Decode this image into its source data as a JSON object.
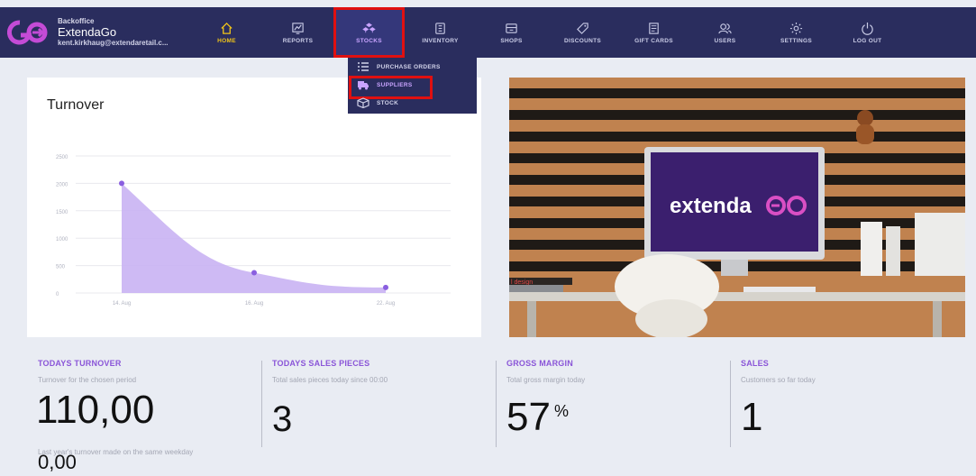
{
  "header": {
    "app_small": "Backoffice",
    "app_name": "ExtendaGo",
    "user_email": "kent.kirkhaug@extendaretail.c..."
  },
  "nav": {
    "home": "HOME",
    "reports": "REPORTS",
    "stocks": "STOCKS",
    "inventory": "INVENTORY",
    "shops": "SHOPS",
    "discounts": "DISCOUNTS",
    "gift_cards": "GIFT CARDS",
    "users": "USERS",
    "settings": "SETTINGS",
    "logout": "LOG OUT"
  },
  "stocks_menu": {
    "purchase_orders": "PURCHASE ORDERS",
    "suppliers": "SUPPLIERS",
    "stock": "STOCK"
  },
  "turnover_card": {
    "title": "Turnover"
  },
  "chart_data": {
    "type": "area",
    "title": "Turnover",
    "x": [
      "14. Aug",
      "16. Aug",
      "22. Aug"
    ],
    "series": [
      {
        "values": [
          2000,
          370,
          100
        ]
      }
    ],
    "yticks": [
      0,
      500,
      1000,
      1500,
      2000,
      2500
    ],
    "xticks": [
      "14. Aug",
      "16. Aug",
      "22. Aug"
    ],
    "ylim": [
      0,
      2500
    ],
    "grid": true,
    "colors": {
      "fill": "#c9b2f3",
      "marker": "#8a5fe0"
    }
  },
  "promo": {
    "brand_text": "extenda",
    "desk_label": "l design"
  },
  "stats": {
    "todays_turnover": {
      "title": "TODAYS TURNOVER",
      "subtitle": "Turnover for the chosen period",
      "value": "110,00",
      "last_year_label": "Last year's turnover made on the same weekday",
      "last_year_value": "0,00"
    },
    "todays_sales_pieces": {
      "title": "TODAYS SALES PIECES",
      "subtitle": "Total sales pieces today since 00:00",
      "value": "3"
    },
    "gross_margin": {
      "title": "GROSS MARGIN",
      "subtitle": "Total gross margin today",
      "value": "57",
      "unit": "%"
    },
    "sales": {
      "title": "SALES",
      "subtitle": "Customers so far today",
      "value": "1"
    }
  },
  "colors": {
    "nav_bg": "#2a2d5e",
    "accent_purple": "#8a55d8",
    "home_yellow": "#f0c419",
    "highlight_red": "#e01010"
  }
}
